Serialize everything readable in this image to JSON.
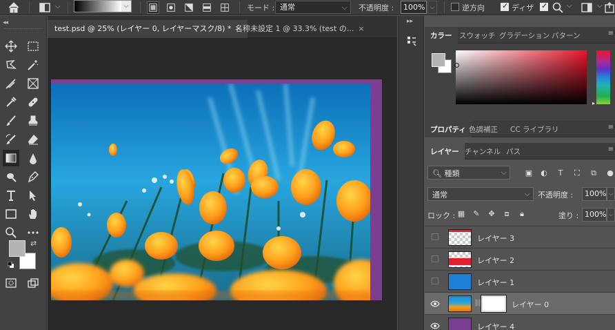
{
  "options_bar": {
    "home_icon": "home-icon",
    "mode_label": "モード :",
    "mode_value": "通常",
    "opacity_label": "不透明度 :",
    "opacity_value": "100%",
    "reverse_label": "逆方向",
    "dither_label": "ディザ",
    "transparency_checked": true,
    "dither_checked": true,
    "reverse_checked": false
  },
  "document": {
    "tabs": [
      {
        "label": "test.psd @ 25% (レイヤー 0, レイヤーマスク/8) *",
        "close": "×",
        "active": true
      },
      {
        "label": "名称未設定 1 @ 33.3% (test の...",
        "close": "×",
        "active": false
      }
    ]
  },
  "toolbar": {
    "collapse": "◂◂",
    "tools": [
      "move-icon",
      "marquee-icon",
      "lasso-icon",
      "magic-wand-icon",
      "crop-icon",
      "frame-icon",
      "eyedropper-icon",
      "healing-brush-icon",
      "brush-icon",
      "stamp-icon",
      "history-brush-icon",
      "eraser-icon",
      "gradient-icon",
      "blur-icon",
      "dodge-icon",
      "pen-icon",
      "type-icon",
      "path-select-icon",
      "rectangle-icon",
      "hand-icon",
      "zoom-icon",
      "more-icon",
      "quick-mask-icon",
      "screen-mode-icon"
    ],
    "foreground_color": "#b4b4b4",
    "background_color": "#ffffff"
  },
  "dock": {
    "collapse": "▸▸"
  },
  "color_panel": {
    "tabs": [
      "カラー",
      "スウォッチ",
      "グラデーション",
      "パターン"
    ],
    "active_tab": "カラー",
    "menu": "≡"
  },
  "props_panel": {
    "tabs": [
      "プロパティ",
      "色調補正",
      "CC ライブラリ"
    ],
    "menu": "≡"
  },
  "layers_panel": {
    "tabs": [
      "レイヤー",
      "チャンネル",
      "パス"
    ],
    "menu": "≡",
    "filter_label": "種類",
    "blend_mode": "通常",
    "opacity_label": "不透明度 :",
    "opacity_value": "100%",
    "lock_label": "ロック :",
    "fill_label": "塗り :",
    "fill_value": "100%",
    "layers": [
      {
        "name": "レイヤー 3",
        "visible": false,
        "thumb": "checker-red-top"
      },
      {
        "name": "レイヤー 2",
        "visible": false,
        "thumb": "checker-red-bottom"
      },
      {
        "name": "レイヤー 1",
        "visible": false,
        "thumb": "#1e7fd6"
      },
      {
        "name": "レイヤー 0",
        "visible": true,
        "thumb": "photo",
        "selected": true,
        "has_mask": true
      },
      {
        "name": "レイヤー 4",
        "visible": true,
        "thumb": "#7b3f91"
      }
    ]
  }
}
